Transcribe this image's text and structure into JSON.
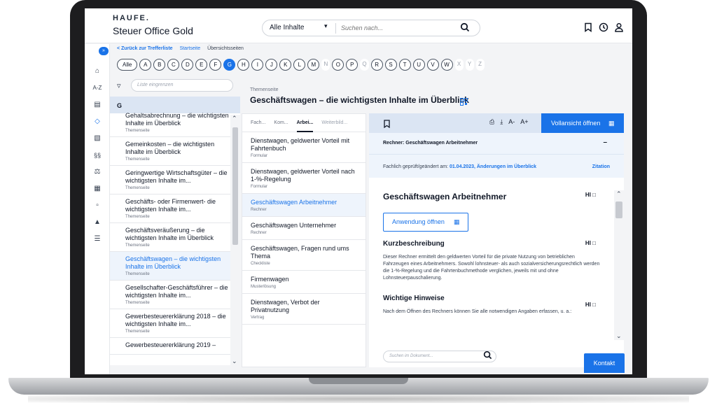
{
  "header": {
    "brand": "HAUFE.",
    "product": "Steuer Office Gold",
    "scope": "Alle Inhalte",
    "search_placeholder": "Suchen nach..."
  },
  "breadcrumb": {
    "back": "< Zurück zur Trefferliste",
    "home": "Startseite",
    "current": "Übersichtsseiten"
  },
  "alphabet": {
    "all": "Alle",
    "letters": [
      "A",
      "B",
      "C",
      "D",
      "E",
      "F",
      "G",
      "H",
      "I",
      "J",
      "K",
      "L",
      "M",
      "N",
      "O",
      "P",
      "Q",
      "R",
      "S",
      "T",
      "U",
      "V",
      "W",
      "X",
      "Y",
      "Z"
    ],
    "active": "G",
    "disabled": [
      "N",
      "Q",
      "X",
      "Y",
      "Z"
    ]
  },
  "list": {
    "filter_placeholder": "Liste eingrenzen",
    "group": "G",
    "items": [
      {
        "title": "Gehaltsabrechnung – die wichtigsten Inhalte im Überblick",
        "type": "Themenseite"
      },
      {
        "title": "Gemeinkosten – die wichtigsten Inhalte im Überblick",
        "type": "Themenseite"
      },
      {
        "title": "Geringwertige Wirtschaftsgüter – die wichtigsten Inhalte im...",
        "type": "Themenseite"
      },
      {
        "title": "Geschäfts- oder Firmenwert- die wichtigsten Inhalte im...",
        "type": "Themenseite"
      },
      {
        "title": "Geschäftsveräußerung – die wichtigsten Inhalte im Überblick",
        "type": "Themenseite"
      },
      {
        "title": "Geschäftswagen – die wichtigsten Inhalte im Überblick",
        "type": "Themenseite"
      },
      {
        "title": "Gesellschafter-Geschäftsführer – die wichtigsten Inhalte im...",
        "type": "Themenseite"
      },
      {
        "title": "Gewerbesteuererklärung 2018 – die wichtigsten Inhalte im...",
        "type": "Themenseite"
      },
      {
        "title": "Gewerbesteuererklärung 2019 –",
        "type": ""
      }
    ]
  },
  "theme": {
    "label": "Themenseite",
    "title": "Geschäftswagen – die wichtigsten Inhalte im Überblick"
  },
  "docs": {
    "tabs": [
      "Fach...",
      "Kom...",
      "Arbei...",
      "Weiterbild..."
    ],
    "items": [
      {
        "title": "Dienstwagen, geldwerter Vorteil mit Fahrtenbuch",
        "type": "Formular"
      },
      {
        "title": "Dienstwagen, geldwerter Vorteil nach 1-%-Regelung",
        "type": "Formular"
      },
      {
        "title": "Geschäftswagen Arbeitnehmer",
        "type": "Rechner"
      },
      {
        "title": "Geschäftswagen Unternehmer",
        "type": "Rechner"
      },
      {
        "title": "Geschäftswagen, Fragen rund ums Thema",
        "type": "Checkliste"
      },
      {
        "title": "Firmenwagen",
        "type": "Musterlösung"
      },
      {
        "title": "Dienstwagen, Verbot der Privatnutzung",
        "type": "Vertrag"
      }
    ]
  },
  "detail": {
    "toolbar": {
      "font_down": "A-",
      "font_up": "A+",
      "full_view": "Vollansicht öffnen"
    },
    "calc_label": "Rechner: Geschäftswagen Arbeitnehmer",
    "collapse": "–",
    "checked_label": "Fachlich geprüft/geändert am:",
    "checked_date": "01.04.2023, Änderungen im Überblick",
    "citation": "Zitation",
    "title": "Geschäftswagen Arbeitnehmer",
    "hi": "HI",
    "open_app": "Anwendung öffnen",
    "short_desc_title": "Kurzbeschreibung",
    "short_desc_text": "Dieser Rechner ermittelt den geldwerten Vorteil für die private Nutzung von betrieblichen Fahrzeugen eines Arbeitnehmers. Sowohl lohnsteuer- als auch sozialversicherungsrechtlich werden die 1-%-Regelung und die Fahrtenbuchmethode verglichen, jeweils mit und ohne Lohnsteuerpauschalierung.",
    "notes_title": "Wichtige Hinweise",
    "notes_text": "Nach dem Öffnen des Rechners können Sie alle notwendigen Angaben erfassen, u. a.:",
    "search_placeholder": "Suchen im Dokument..."
  },
  "contact": "Kontakt",
  "colors": {
    "accent": "#1a73e8",
    "panel": "#dbe5f3"
  }
}
